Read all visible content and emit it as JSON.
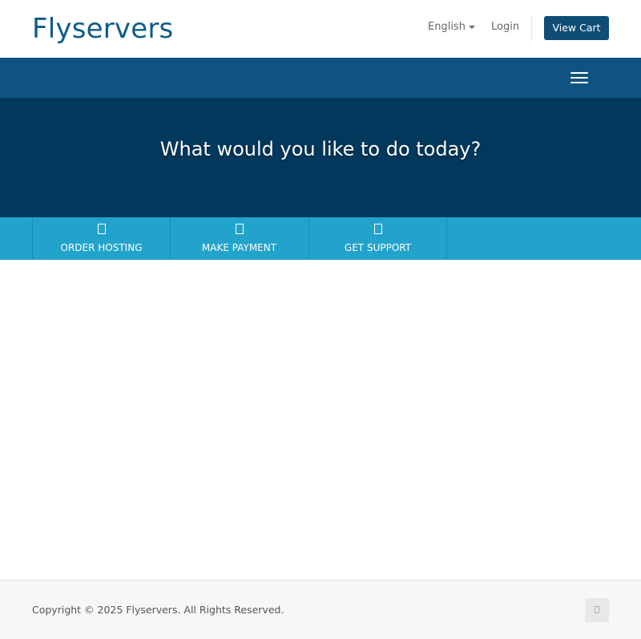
{
  "header": {
    "logo": "Flyservers",
    "language": "English",
    "login": "Login",
    "view_cart": "View Cart"
  },
  "hero": {
    "title": "What would you like to do today?"
  },
  "actions": [
    {
      "label": "ORDER HOSTING",
      "icon": "box-icon"
    },
    {
      "label": "MAKE PAYMENT",
      "icon": "box-icon"
    },
    {
      "label": "GET SUPPORT",
      "icon": "box-icon"
    }
  ],
  "footer": {
    "copyright": "Copyright © 2025 Flyservers. All Rights Reserved.",
    "back_to_top_icon": "box-icon"
  },
  "colors": {
    "brand": "#0f5c88",
    "navbar": "#0f5480",
    "hero": "#02385c",
    "action_bar": "#22a3cb",
    "cart_button": "#0f4d76"
  }
}
